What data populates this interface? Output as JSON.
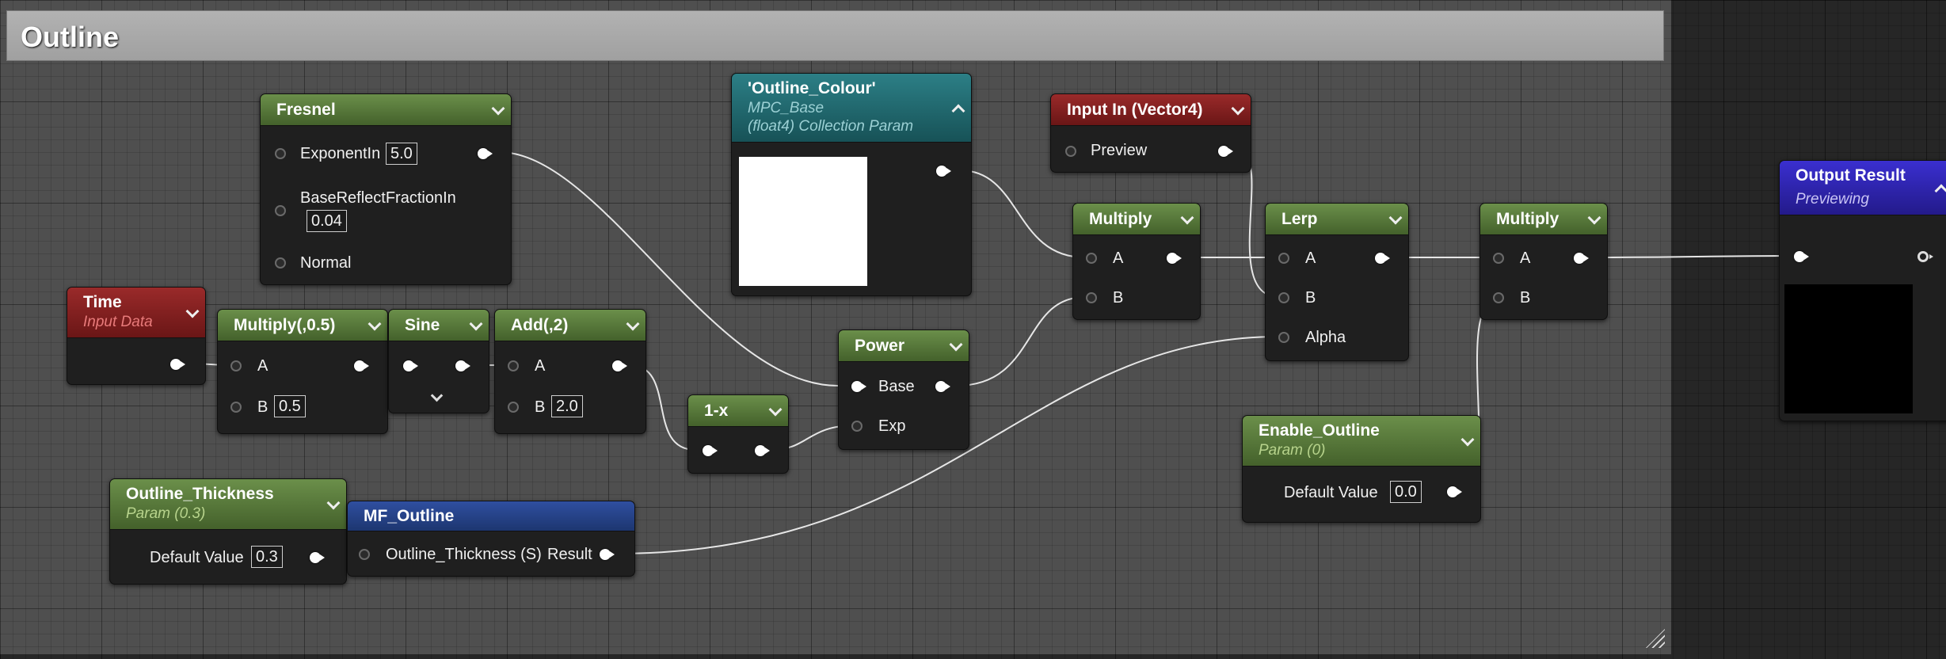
{
  "comment": {
    "title": "Outline"
  },
  "nodes": {
    "fresnel": {
      "title": "Fresnel",
      "pins": {
        "exponent_label": "ExponentIn",
        "exponent_value": "5.0",
        "base_reflect_label": "BaseReflectFractionIn",
        "base_reflect_value": "0.04",
        "normal_label": "Normal"
      }
    },
    "outline_colour": {
      "title": "'Outline_Colour'",
      "sub1": "MPC_Base",
      "sub2": "(float4) Collection Param"
    },
    "input_in": {
      "title": "Input In (Vector4)",
      "preview_label": "Preview"
    },
    "time": {
      "title": "Time",
      "subtitle": "Input Data"
    },
    "multiply_half": {
      "title": "Multiply(,0.5)",
      "a_label": "A",
      "b_label": "B",
      "b_value": "0.5"
    },
    "sine": {
      "title": "Sine"
    },
    "add": {
      "title": "Add(,2)",
      "a_label": "A",
      "b_label": "B",
      "b_value": "2.0"
    },
    "one_minus": {
      "title": "1-x"
    },
    "power": {
      "title": "Power",
      "base_label": "Base",
      "exp_label": "Exp"
    },
    "multiply1": {
      "title": "Multiply",
      "a_label": "A",
      "b_label": "B"
    },
    "lerp": {
      "title": "Lerp",
      "a_label": "A",
      "b_label": "B",
      "alpha_label": "Alpha"
    },
    "multiply2": {
      "title": "Multiply",
      "a_label": "A",
      "b_label": "B"
    },
    "output": {
      "title": "Output Result",
      "subtitle": "Previewing"
    },
    "outline_thickness": {
      "title": "Outline_Thickness",
      "subtitle": "Param (0.3)",
      "default_label": "Default Value",
      "default_value": "0.3"
    },
    "mf_outline": {
      "title": "MF_Outline",
      "input_label": "Outline_Thickness (S)",
      "output_label": "Result"
    },
    "enable_outline": {
      "title": "Enable_Outline",
      "subtitle": "Param (0)",
      "default_label": "Default Value",
      "default_value": "0.0"
    }
  }
}
